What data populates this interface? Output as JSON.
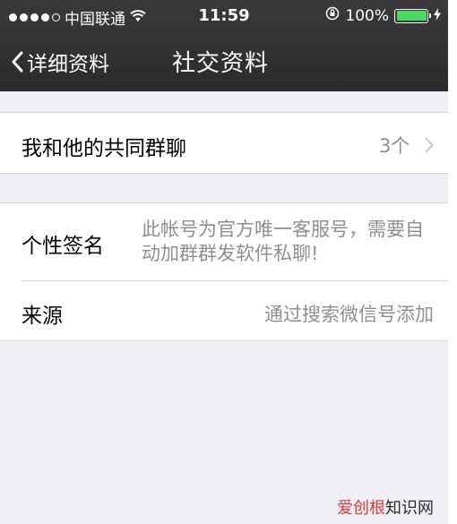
{
  "status_bar": {
    "carrier": "中国联通",
    "time": "11:59",
    "battery": "100%",
    "battery_level": 1.0,
    "signal_dots_filled": 4,
    "signal_dots_total": 5,
    "icons": [
      "wifi-icon",
      "rotation-lock-icon",
      "battery-icon",
      "charging-bolt-icon"
    ]
  },
  "nav": {
    "back_label": "详细资料",
    "title": "社交资料"
  },
  "groups": {
    "common_chats": {
      "label": "我和他的共同群聊",
      "value": "3个"
    },
    "signature": {
      "label": "个性签名",
      "value": "此帐号为官方唯一客服号，需要自动加群群发软件私聊!"
    },
    "source": {
      "label": "来源",
      "value": "通过搜索微信号添加"
    }
  },
  "watermark": {
    "brand": "爱创根",
    "suffix": "知识网"
  },
  "colors": {
    "nav_background": "#2e2e30",
    "page_background": "#efeff4",
    "secondary_text": "#8e8e93",
    "battery_fill": "#4cd964",
    "watermark_accent": "#e0393b"
  }
}
